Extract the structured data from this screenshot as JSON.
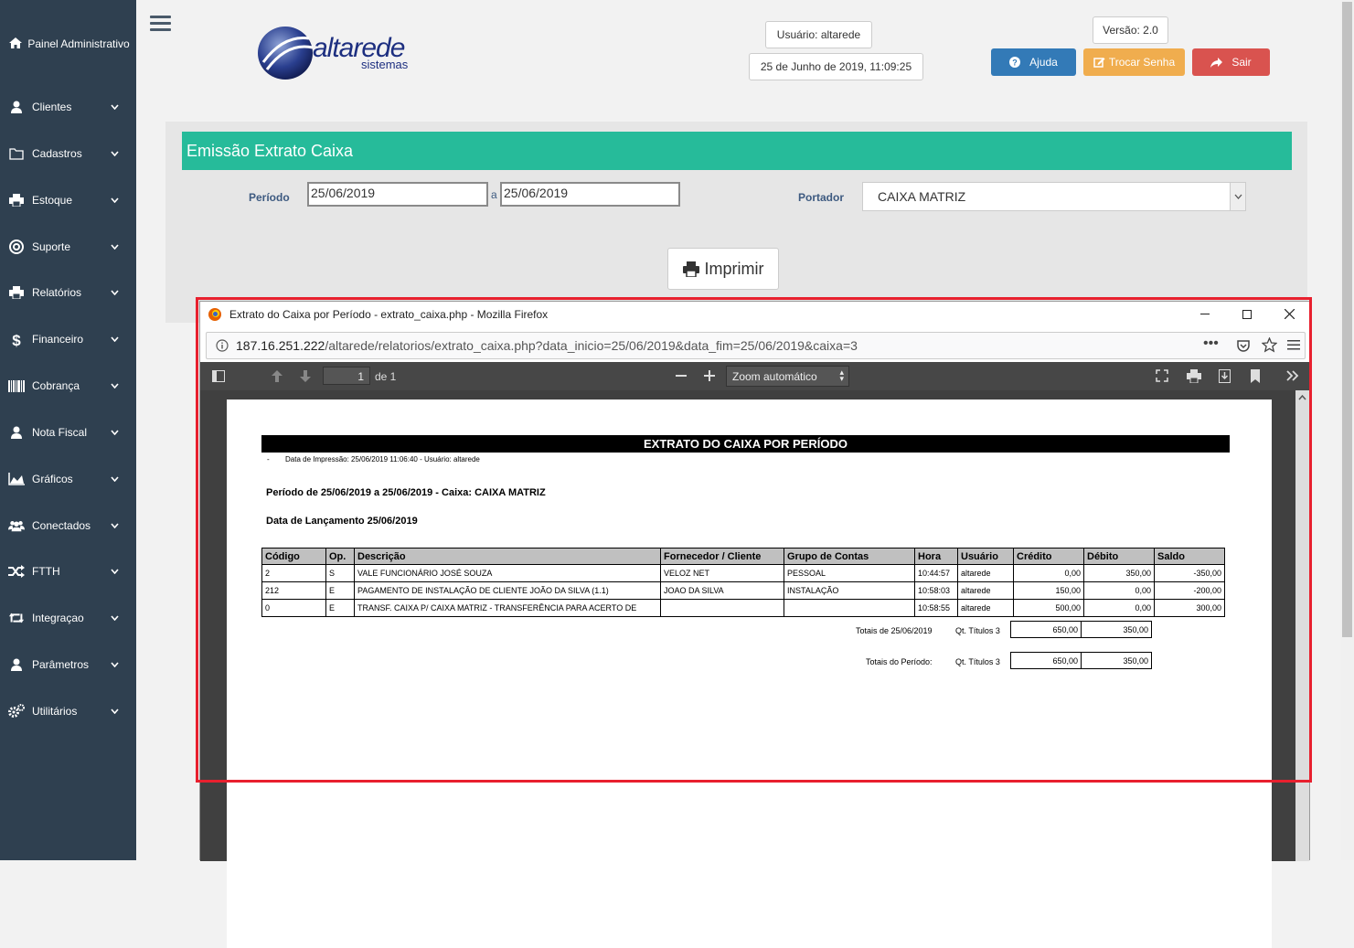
{
  "sidebar": {
    "top": "Painel Administrativo",
    "items": [
      {
        "label": "Clientes",
        "icon": "user-icon"
      },
      {
        "label": "Cadastros",
        "icon": "folder-icon"
      },
      {
        "label": "Estoque",
        "icon": "print-icon"
      },
      {
        "label": "Suporte",
        "icon": "lifebuoy-icon"
      },
      {
        "label": "Relatórios",
        "icon": "print-icon"
      },
      {
        "label": "Financeiro",
        "icon": "dollar-icon"
      },
      {
        "label": "Cobrança",
        "icon": "barcode-icon"
      },
      {
        "label": "Nota Fiscal",
        "icon": "user-icon"
      },
      {
        "label": "Gráficos",
        "icon": "area-chart-icon"
      },
      {
        "label": "Conectados",
        "icon": "users-icon"
      },
      {
        "label": "FTTH",
        "icon": "random-icon"
      },
      {
        "label": "Integraçao",
        "icon": "retweet-icon"
      },
      {
        "label": "Parâmetros",
        "icon": "user-icon"
      },
      {
        "label": "Utilitários",
        "icon": "cogs-icon"
      }
    ]
  },
  "header": {
    "logo_main": "altarede",
    "logo_sub": "sistemas",
    "user": "Usuário: altarede",
    "datetime": "25 de Junho de 2019, 11:09:25",
    "version": "Versão: 2.0",
    "help": "Ajuda",
    "change_password": "Trocar Senha",
    "logout": "Sair"
  },
  "form": {
    "title": "Emissão Extrato Caixa",
    "period_label": "Período",
    "date_start": "25/06/2019",
    "separator": "a",
    "date_end": "25/06/2019",
    "portador_label": "Portador",
    "portador_value": "CAIXA MATRIZ",
    "print_button": "Imprimir"
  },
  "colors": {
    "sidebar": "#2f4050",
    "title_bar": "#26bb9a",
    "help_btn": "#337ab7",
    "change_pwd_btn": "#f0ad4e",
    "logout_btn": "#d9534f",
    "highlight": "#e8202e"
  },
  "browser": {
    "window_title": "Extrato do Caixa por Período - extrato_caixa.php - Mozilla Firefox",
    "url_host": "187.16.251.222",
    "url_path": "/altarede/relatorios/extrato_caixa.php?data_inicio=25/06/2019&data_fim=25/06/2019&caixa=3",
    "page_num": "1",
    "page_of": "de 1",
    "zoom": "Zoom automático"
  },
  "report": {
    "title": "EXTRATO DO CAIXA POR PERÍODO",
    "dash": "-",
    "print_info": "Data de Impressão: 25/06/2019 11:06:40 - Usuário: altarede",
    "period": "Período de 25/06/2019 a 25/06/2019 - Caixa: CAIXA MATRIZ",
    "launch_date": "Data de Lançamento 25/06/2019",
    "headers": [
      "Código",
      "Op.",
      "Descrição",
      "Fornecedor / Cliente",
      "Grupo de Contas",
      "Hora",
      "Usuário",
      "Crédito",
      "Débito",
      "Saldo"
    ],
    "rows": [
      [
        "2",
        "S",
        "VALE FUNCIONÁRIO JOSÉ SOUZA",
        "VELOZ NET",
        "PESSOAL",
        "10:44:57",
        "altarede",
        "0,00",
        "350,00",
        "-350,00"
      ],
      [
        "212",
        "E",
        "PAGAMENTO DE INSTALAÇÃO DE CLIENTE JOÃO DA SILVA (1.1)",
        "JOAO DA SILVA",
        "INSTALAÇÃO",
        "10:58:03",
        "altarede",
        "150,00",
        "0,00",
        "-200,00"
      ],
      [
        "0",
        "E",
        "TRANSF. CAIXA P/ CAIXA MATRIZ - TRANSFERÊNCIA PARA ACERTO DE",
        "",
        "",
        "10:58:55",
        "altarede",
        "500,00",
        "0,00",
        "300,00"
      ]
    ],
    "day_total_label": "Totais de 25/06/2019",
    "day_titles": "Qt. Títulos 3",
    "day_credit": "650,00",
    "day_debit": "350,00",
    "period_total_label": "Totais do Período:",
    "period_titles": "Qt. Títulos 3",
    "period_credit": "650,00",
    "period_debit": "350,00"
  }
}
